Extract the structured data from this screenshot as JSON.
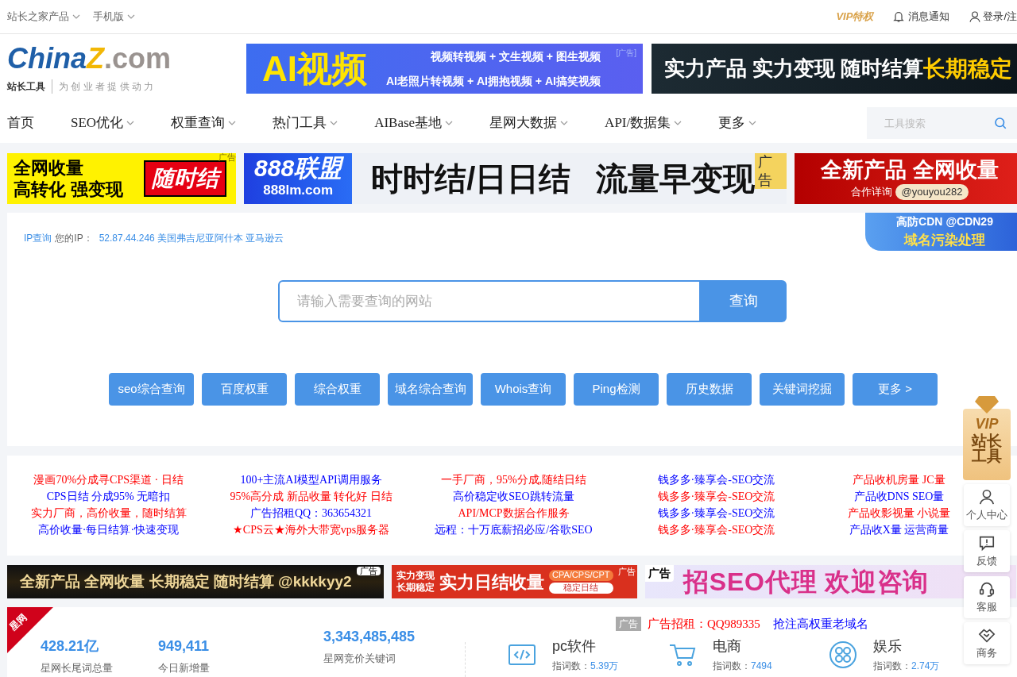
{
  "top_bar": {
    "left": [
      {
        "label": "站长之家产品",
        "dropdown": true
      },
      {
        "label": "手机版",
        "dropdown": true
      }
    ],
    "vip": "VIP特权",
    "notify": "消息通知",
    "login": "登录/注"
  },
  "logo": {
    "brand": "China",
    "mark": "Z",
    "suffix": ".com",
    "tagline_bold": "站长工具",
    "tagline": "为 创 业 者 提 供 动 力"
  },
  "header_ads": [
    {
      "kind": "ai-video",
      "texts": [
        "AI视频",
        "视频转视频 + 文生视频 + 图生视频",
        "AI老照片转视频 + AI拥抱视频 + AI搞笑视频",
        "[广告]"
      ]
    },
    {
      "kind": "dark",
      "texts": [
        "实力产品 实力变现 随时结算",
        "长期稳定"
      ]
    }
  ],
  "nav": [
    {
      "label": "首页",
      "dropdown": false
    },
    {
      "label": "SEO优化",
      "dropdown": true
    },
    {
      "label": "权重查询",
      "dropdown": true
    },
    {
      "label": "热门工具",
      "dropdown": true
    },
    {
      "label": "AIBase基地",
      "dropdown": true
    },
    {
      "label": "星网大数据",
      "dropdown": true
    },
    {
      "label": "API/数据集",
      "dropdown": true
    },
    {
      "label": "更多",
      "dropdown": true
    }
  ],
  "tool_search": {
    "placeholder": "工具搜索"
  },
  "ad_row_1": [
    {
      "kind": "yellow",
      "texts": [
        "全网收量",
        "高转化 强变现",
        "随时结",
        "广告"
      ]
    },
    {
      "kind": "bluelogo",
      "texts": [
        "888联盟",
        "888lm.com",
        "时时结/日日结",
        "流量早变现",
        "广告"
      ]
    },
    {
      "kind": "red",
      "texts": [
        "全新产品 全网收量",
        "合作详询",
        "@youyou282"
      ]
    }
  ],
  "ip_query": {
    "link": "IP查询",
    "label": "您的IP：",
    "value": "52.87.44.246 美国弗吉尼亚阿什本 亚马逊云"
  },
  "cdn_ad": {
    "texts": [
      "高防CDN",
      "@CDN29",
      "域名污染处理"
    ]
  },
  "site_search": {
    "placeholder": "请输入需要查询的网站",
    "button": "查询"
  },
  "quick_tools": [
    "seo综合查询",
    "百度权重",
    "综合权重",
    "域名综合查询",
    "Whois查询",
    "Ping检测",
    "历史数据",
    "关键词挖掘",
    "更多 >"
  ],
  "text_ads": [
    [
      {
        "text": "漫画70%分成寻CPS渠道 · 日结",
        "color": "#ff0000"
      },
      {
        "text": "CPS日结 分成95% 无暗扣",
        "color": "#0000ff"
      },
      {
        "text": "实力厂商，高价收量，随时结算",
        "color": "#ff0000"
      },
      {
        "text": "高价收量·每日结算·快速变现",
        "color": "#0000ff"
      }
    ],
    [
      {
        "text": "100+主流AI模型API调用服务",
        "color": "#0000ff"
      },
      {
        "text": "95%高分成 新品收量 转化好 日结",
        "color": "#ff0000"
      },
      {
        "text": "广告招租QQ：363654321",
        "color": "#0000ff"
      },
      {
        "text": "★CPS云★海外大带宽vps服务器",
        "color": "#ff0000"
      }
    ],
    [
      {
        "text": "一手厂商，95%分成,随结日结",
        "color": "#ff0000"
      },
      {
        "text": "高价稳定收SEO跳转流量",
        "color": "#0000ff"
      },
      {
        "text": "API/MCP数据合作服务",
        "color": "#ff0000"
      },
      {
        "text": "远程：十万底薪招必应/谷歌SEO",
        "color": "#0000ff"
      }
    ],
    [
      {
        "text": "钱多多·臻享会-SEO交流",
        "color": "#0000ff"
      },
      {
        "text": "钱多多·臻享会-SEO交流",
        "color": "#ff0000"
      },
      {
        "text": "钱多多·臻享会-SEO交流",
        "color": "#0000ff"
      },
      {
        "text": "钱多多·臻享会-SEO交流",
        "color": "#ff0000"
      }
    ],
    [
      {
        "text": "产品收机房量 JC量",
        "color": "#ff0000"
      },
      {
        "text": "产品收DNS SEO量",
        "color": "#0000ff"
      },
      {
        "text": "产品收影视量 小说量",
        "color": "#ff0000"
      },
      {
        "text": "产品收X量 运营商量",
        "color": "#0000ff"
      }
    ]
  ],
  "ad_row_2": [
    {
      "kind": "gold",
      "texts": [
        "全新产品 全网收量 长期稳定 随时结算 @kkkkyy2",
        "广告"
      ]
    },
    {
      "kind": "red2",
      "texts": [
        "实力变现",
        "长期稳定",
        "实力日结收量",
        "CPA/CPS/CPT",
        "稳定日结",
        "广告"
      ]
    },
    {
      "kind": "pink",
      "texts": [
        "广告",
        "招SEO代理 欢迎咨询"
      ]
    }
  ],
  "xingwang": {
    "ribbon": "星网",
    "stats": [
      {
        "value": "428.21亿",
        "label": "星网长尾词总量"
      },
      {
        "value": "949,411",
        "label": "今日新增量"
      },
      {
        "value": "3,343,485,485",
        "label": "星网竞价关键词"
      }
    ],
    "ad_line": {
      "tag": "广告",
      "red": "广告招租：QQ989335",
      "blue": "抢注高权重老域名"
    },
    "categories": [
      {
        "kind": "code",
        "name": "pc软件",
        "label": "指词数：",
        "value": "5.39万"
      },
      {
        "kind": "cart",
        "name": "电商",
        "label": "指词数：",
        "value": "7494"
      },
      {
        "kind": "dots",
        "name": "娱乐",
        "label": "指词数：",
        "value": "2.74万"
      }
    ]
  },
  "float_bar": {
    "vip": [
      "VIP",
      "站长",
      "工具"
    ],
    "items": [
      {
        "kind": "user",
        "label": "个人中心"
      },
      {
        "kind": "feedback",
        "label": "反馈"
      },
      {
        "kind": "headset",
        "label": "客服"
      },
      {
        "kind": "handshake",
        "label": "商务"
      }
    ]
  }
}
